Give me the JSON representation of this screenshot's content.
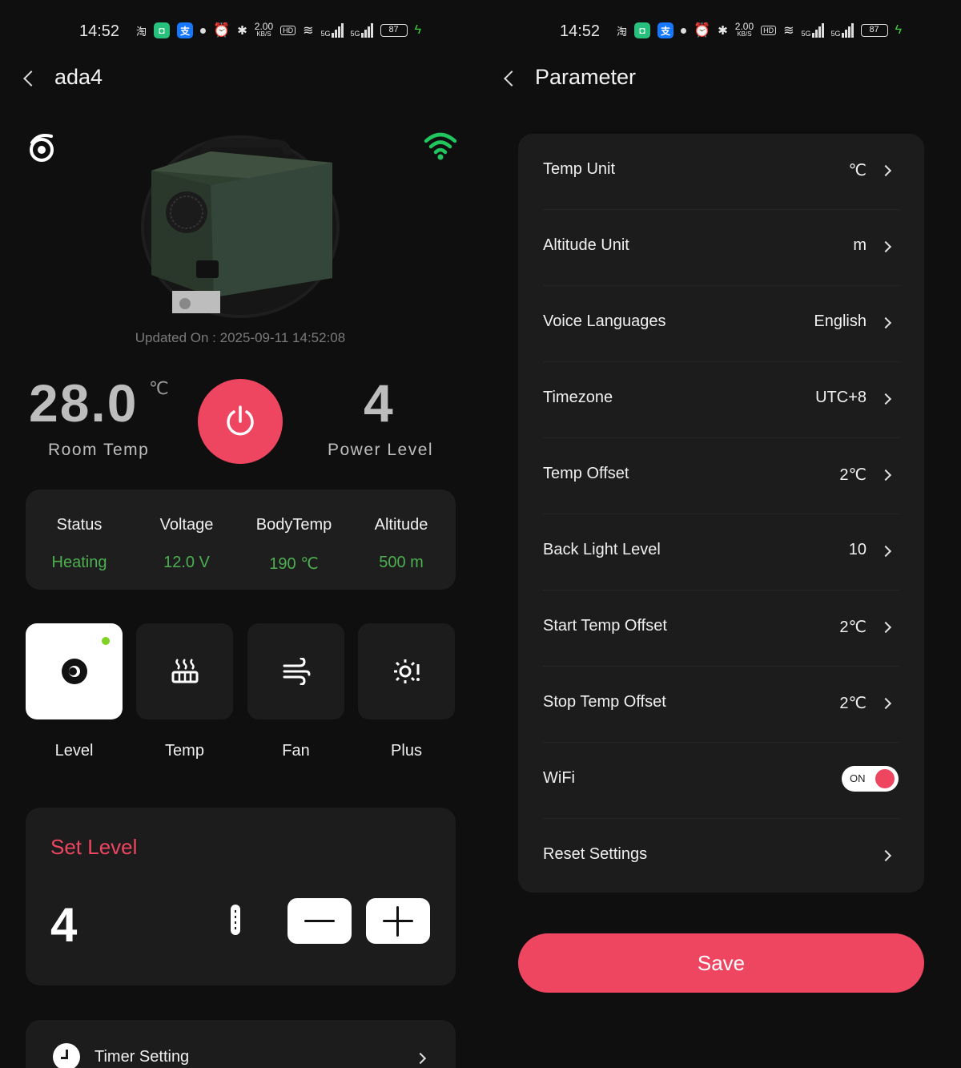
{
  "status_bar": {
    "time": "14:52",
    "net_speed": "2.00",
    "net_speed_unit": "KB/S",
    "hd_label": "HD",
    "sig_label": "5G",
    "battery": "87"
  },
  "device_screen": {
    "title": "ada4",
    "updated_on": "Updated On : 2025-09-11 14:52:08",
    "room_temp": {
      "value": "28.0",
      "unit": "℃",
      "label": "Room Temp"
    },
    "power_level": {
      "value": "4",
      "label": "Power Level"
    },
    "stats": [
      {
        "label": "Status",
        "value": "Heating"
      },
      {
        "label": "Voltage",
        "value": "12.0 V"
      },
      {
        "label": "BodyTemp",
        "value": "190 ℃"
      },
      {
        "label": "Altitude",
        "value": "500 m"
      }
    ],
    "modes": [
      {
        "label": "Level",
        "icon": "level-icon",
        "active": true
      },
      {
        "label": "Temp",
        "icon": "heater-icon",
        "active": false
      },
      {
        "label": "Fan",
        "icon": "wind-icon",
        "active": false
      },
      {
        "label": "Plus",
        "icon": "plus-mode-icon",
        "active": false
      }
    ],
    "set_level": {
      "title": "Set Level",
      "value": "4"
    },
    "timer": {
      "label": "Timer Setting"
    }
  },
  "parameter_screen": {
    "title": "Parameter",
    "rows": [
      {
        "label": "Temp Unit",
        "value": "℃"
      },
      {
        "label": "Altitude Unit",
        "value": "m"
      },
      {
        "label": "Voice Languages",
        "value": "English"
      },
      {
        "label": "Timezone",
        "value": "UTC+8"
      },
      {
        "label": "Temp Offset",
        "value": "2℃"
      },
      {
        "label": "Back Light Level",
        "value": "10"
      },
      {
        "label": "Start Temp Offset",
        "value": "2℃"
      },
      {
        "label": "Stop Temp Offset",
        "value": "2℃"
      },
      {
        "label": "WiFi",
        "toggle": "ON"
      },
      {
        "label": "Reset Settings",
        "value": ""
      }
    ],
    "save_label": "Save"
  },
  "colors": {
    "accent": "#ee4560",
    "status_green": "#4caf50",
    "wifi_green": "#22c55e",
    "background": "#0f0f0f",
    "card": "#1c1c1c"
  }
}
